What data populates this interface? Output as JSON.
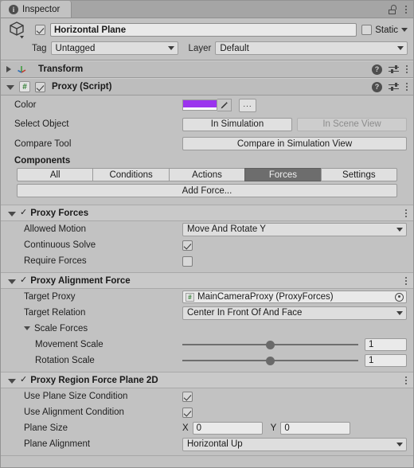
{
  "tab": {
    "label": "Inspector",
    "icon": "info-icon"
  },
  "titlebar": {
    "lock_icon": "lock-open-icon",
    "menu_icon": "kebab-menu-icon"
  },
  "gameobject": {
    "icon": "cube-icon",
    "enabled": true,
    "name": "Horizontal Plane",
    "static_label": "Static",
    "static_checked": false,
    "tag_label": "Tag",
    "tag_value": "Untagged",
    "layer_label": "Layer",
    "layer_value": "Default"
  },
  "transform": {
    "title": "Transform",
    "icon": "transform-axis-icon",
    "expanded": false,
    "help_icon": "help-icon",
    "preset_icon": "preset-sliders-icon",
    "menu_icon": "kebab-menu-icon"
  },
  "proxy": {
    "title": "Proxy (Script)",
    "script_icon": "script-hash-icon",
    "enabled": true,
    "expanded": true,
    "help_icon": "help-icon",
    "preset_icon": "preset-sliders-icon",
    "menu_icon": "kebab-menu-icon",
    "color": {
      "label": "Color",
      "value": "#9B34EE",
      "eyedropper_icon": "eyedropper-icon",
      "more_label": "..."
    },
    "select_object": {
      "label": "Select Object",
      "primary_button": "In Simulation",
      "secondary_button": "In Scene View",
      "secondary_disabled": true
    },
    "compare_tool": {
      "label": "Compare Tool",
      "button": "Compare in Simulation View"
    },
    "components": {
      "label": "Components",
      "tabs": [
        "All",
        "Conditions",
        "Actions",
        "Forces",
        "Settings"
      ],
      "active_tab": "Forces",
      "add_button": "Add Force..."
    }
  },
  "proxy_forces": {
    "title": "Proxy Forces",
    "checked": true,
    "expanded": true,
    "menu_icon": "kebab-menu-icon",
    "fields": {
      "allowed_motion_label": "Allowed Motion",
      "allowed_motion_value": "Move And Rotate Y",
      "continuous_solve_label": "Continuous Solve",
      "continuous_solve_checked": true,
      "require_forces_label": "Require Forces",
      "require_forces_checked": false
    }
  },
  "proxy_alignment_force": {
    "title": "Proxy Alignment Force",
    "checked": true,
    "expanded": true,
    "menu_icon": "kebab-menu-icon",
    "fields": {
      "target_proxy_label": "Target Proxy",
      "target_proxy_value": "MainCameraProxy (ProxyForces)",
      "target_proxy_icon": "script-hash-icon",
      "target_picker_icon": "object-picker-icon",
      "target_relation_label": "Target Relation",
      "target_relation_value": "Center In Front Of And Face",
      "scale_forces_label": "Scale Forces",
      "scale_forces_expanded": true,
      "movement_scale_label": "Movement Scale",
      "movement_scale_value": "1",
      "movement_scale_percent": 50,
      "rotation_scale_label": "Rotation Scale",
      "rotation_scale_value": "1",
      "rotation_scale_percent": 50
    }
  },
  "proxy_region_force_plane_2d": {
    "title": "Proxy Region Force Plane 2D",
    "checked": true,
    "expanded": true,
    "menu_icon": "kebab-menu-icon",
    "fields": {
      "use_plane_size_condition_label": "Use Plane Size Condition",
      "use_plane_size_condition_checked": true,
      "use_alignment_condition_label": "Use Alignment Condition",
      "use_alignment_condition_checked": true,
      "plane_size_label": "Plane Size",
      "plane_size_x_label": "X",
      "plane_size_x_value": "0",
      "plane_size_y_label": "Y",
      "plane_size_y_value": "0",
      "plane_alignment_label": "Plane Alignment",
      "plane_alignment_value": "Horizontal Up"
    }
  }
}
